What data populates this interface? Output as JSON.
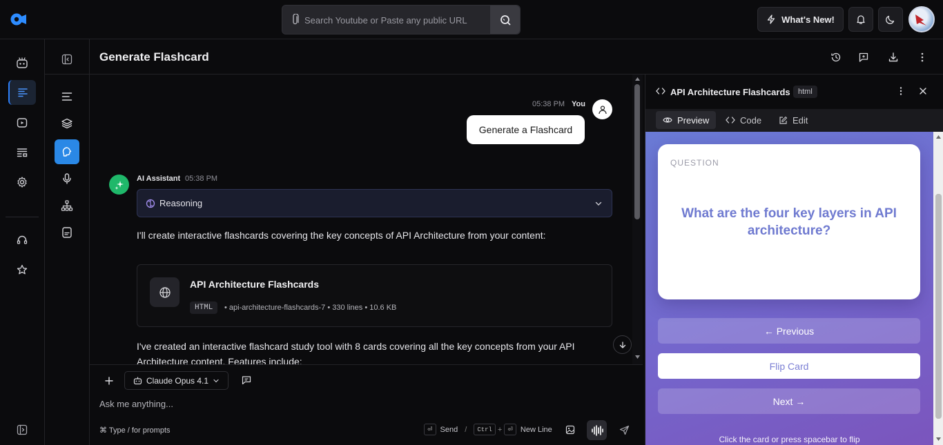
{
  "topbar": {
    "search_placeholder": "Search Youtube or Paste any public URL",
    "whats_new": "What's New!"
  },
  "header": {
    "title": "Generate Flashcard"
  },
  "chat": {
    "user": {
      "time": "05:38 PM",
      "name": "You",
      "text": "Generate a Flashcard"
    },
    "assistant": {
      "name": "AI Assistant",
      "time": "05:38 PM",
      "reasoning_label": "Reasoning",
      "intro": "I'll create interactive flashcards covering the key concepts of API Architecture from your content:",
      "artifact": {
        "title": "API Architecture Flashcards",
        "type": "HTML",
        "meta": "• api-architecture-flashcards-7 • 330 lines • 10.6 KB"
      },
      "outro": "I've created an interactive flashcard study tool with 8 cards covering all the key concepts from your API Architecture content. Features include:"
    }
  },
  "composer": {
    "model": "Claude Opus 4.1",
    "placeholder": "Ask me anything...",
    "hint": "⌘ Type / for prompts",
    "send_key": "⏎",
    "send_label": "Send",
    "separator": "/",
    "ctrl_key": "Ctrl",
    "plus": "+",
    "newline_label": "New Line"
  },
  "panel": {
    "title": "API Architecture Flashcards",
    "badge": "html",
    "tabs": {
      "preview": "Preview",
      "code": "Code",
      "edit": "Edit"
    },
    "flashcard": {
      "label": "QUESTION",
      "question": "What are the four key layers in API architecture?",
      "prev": "← Previous",
      "flip": "Flip Card",
      "next": "Next →",
      "hint": "Click the card or press spacebar to flip"
    }
  },
  "colors": {
    "accent": "#2a88e6",
    "assistant": "#1fb86a",
    "gradient_start": "#6a7bd6",
    "gradient_end": "#7b55bd"
  }
}
